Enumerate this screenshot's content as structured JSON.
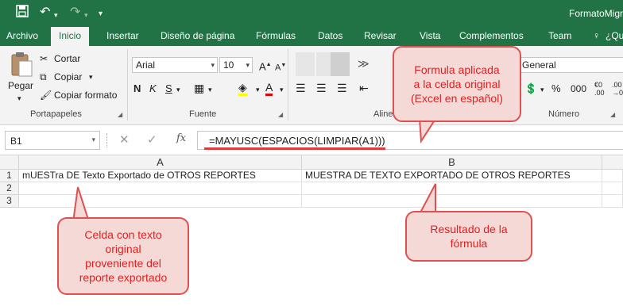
{
  "window": {
    "title": "FormatoMigr",
    "quick_access": {
      "save_icon": "save-icon",
      "undo_icon": "undo-icon",
      "redo_icon": "redo-icon",
      "customize_icon": "customize-qat-icon"
    }
  },
  "tabs": [
    {
      "label": "Archivo"
    },
    {
      "label": "Inicio",
      "active": true
    },
    {
      "label": "Insertar"
    },
    {
      "label": "Diseño de página"
    },
    {
      "label": "Fórmulas"
    },
    {
      "label": "Datos"
    },
    {
      "label": "Revisar"
    },
    {
      "label": "Vista"
    },
    {
      "label": "Complementos"
    },
    {
      "label": "Team"
    },
    {
      "label": "¿Qu"
    }
  ],
  "ribbon": {
    "clipboard": {
      "paste": "Pegar",
      "cut": "Cortar",
      "copy": "Copiar",
      "format_painter": "Copiar formato",
      "group_label": "Portapapeles"
    },
    "font": {
      "font_name": "Arial",
      "font_size": "10",
      "bold": "N",
      "italic": "K",
      "underline": "S",
      "group_label": "Fuente"
    },
    "alignment": {
      "group_label": "Alinea"
    },
    "number": {
      "format": "General",
      "group_label": "Número"
    }
  },
  "formula_bar": {
    "name_box": "B1",
    "cancel": "✕",
    "enter": "✓",
    "fx": "fx",
    "formula": "=MAYUSC(ESPACIOS(LIMPIAR(A1)))"
  },
  "grid": {
    "columns": [
      "A",
      "B"
    ],
    "rows": [
      {
        "num": "1",
        "A": "mUESTra DE Texto Exportado de OTROS REPORTES",
        "B": "MUESTRA DE TEXTO EXPORTADO DE OTROS REPORTES"
      },
      {
        "num": "2",
        "A": "",
        "B": ""
      },
      {
        "num": "3",
        "A": "",
        "B": ""
      }
    ]
  },
  "callouts": {
    "formula": [
      "Formula aplicada",
      "a la celda original",
      "(Excel en español)"
    ],
    "original": [
      "Celda con texto",
      "original",
      "proveniente del",
      "reporte exportado"
    ],
    "result": [
      "Resultado de la",
      "fórmula"
    ]
  },
  "colors": {
    "excel_green": "#217346",
    "callout_fill": "#f4d9d7",
    "callout_border": "#e05050",
    "callout_text": "#e02020"
  }
}
